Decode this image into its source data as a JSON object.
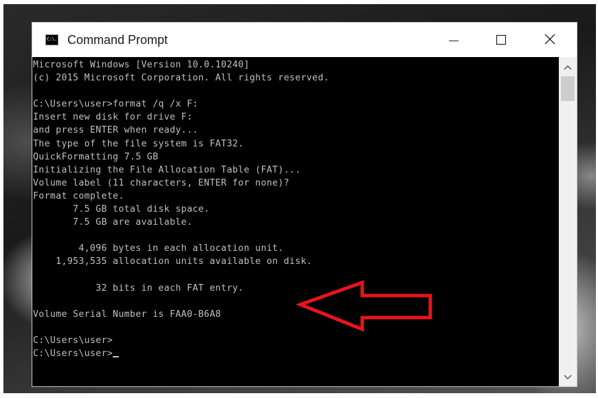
{
  "window": {
    "title": "Command Prompt",
    "icon_text": "C:\\."
  },
  "console": {
    "lines": [
      "Microsoft Windows [Version 10.0.10240]",
      "(c) 2015 Microsoft Corporation. All rights reserved.",
      "",
      "C:\\Users\\user>format /q /x F:",
      "Insert new disk for drive F:",
      "and press ENTER when ready...",
      "The type of the file system is FAT32.",
      "QuickFormatting 7.5 GB",
      "Initializing the File Allocation Table (FAT)...",
      "Volume label (11 characters, ENTER for none)?",
      "Format complete.",
      "       7.5 GB total disk space.",
      "       7.5 GB are available.",
      "",
      "        4,096 bytes in each allocation unit.",
      "    1,953,535 allocation units available on disk.",
      "",
      "           32 bits in each FAT entry.",
      "",
      "Volume Serial Number is FAA0-B6A8",
      "",
      "C:\\Users\\user>",
      "C:\\Users\\user>"
    ]
  },
  "icons": {
    "minimize": "minimize-icon",
    "maximize": "maximize-icon",
    "close": "close-icon",
    "scroll_up": "chevron-up-icon",
    "scroll_down": "chevron-down-icon",
    "annotation": "arrow-left-icon"
  },
  "colors": {
    "console_bg": "#000000",
    "console_text": "#c0c0c0",
    "annotation_arrow": "#e8141b"
  }
}
